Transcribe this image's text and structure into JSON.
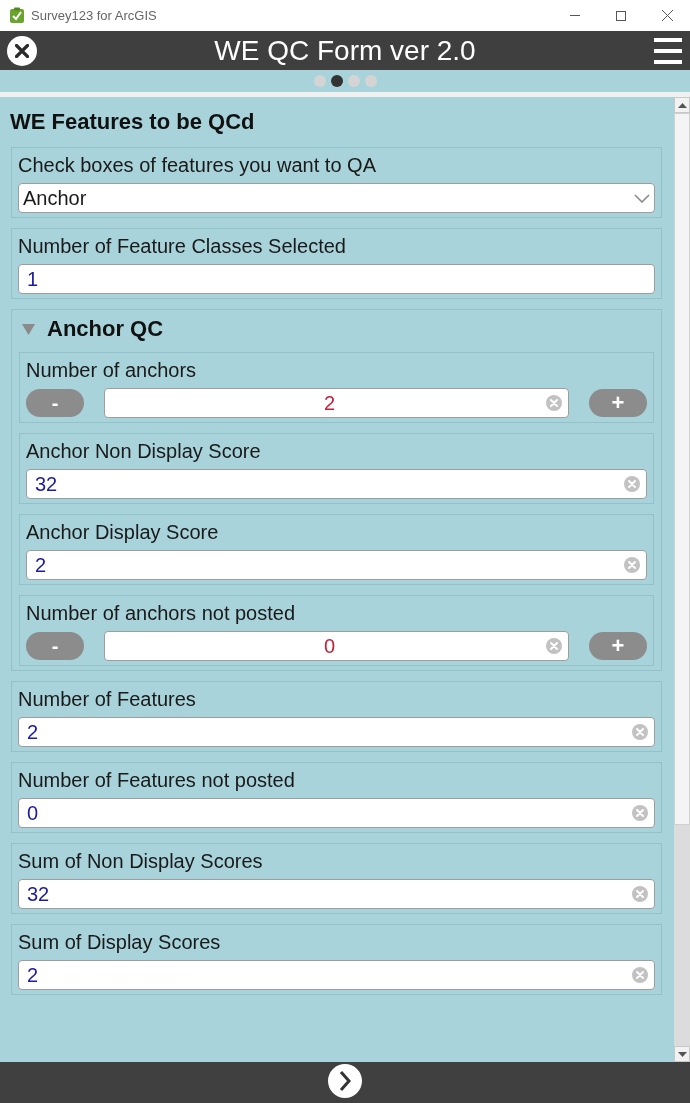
{
  "window": {
    "title": "Survey123 for ArcGIS"
  },
  "header": {
    "title": "WE QC Form ver 2.0"
  },
  "pager": [
    {
      "selected": false
    },
    {
      "selected": true
    },
    {
      "selected": false
    },
    {
      "selected": false
    }
  ],
  "form": {
    "title": "WE Features to be QCd",
    "questions": [
      {
        "kind": "select",
        "label": "Check boxes of features you want to QA",
        "value": "Anchor"
      },
      {
        "kind": "text",
        "label": "Number of Feature Classes Selected",
        "value": "1",
        "clear_button": false
      },
      {
        "kind": "group",
        "label": "Anchor QC",
        "expanded": true,
        "children": [
          {
            "kind": "stepper",
            "label": "Number of anchors",
            "value": "2",
            "minus": "-",
            "plus": "+",
            "clear_button": true
          },
          {
            "kind": "text",
            "label": "Anchor Non Display Score",
            "value": "32",
            "clear_button": true
          },
          {
            "kind": "text",
            "label": "Anchor Display Score",
            "value": "2",
            "clear_button": true
          },
          {
            "kind": "stepper",
            "label": "Number of anchors not posted",
            "value": "0",
            "minus": "-",
            "plus": "+",
            "clear_button": true
          }
        ]
      },
      {
        "kind": "text",
        "label": "Number of Features",
        "value": "2",
        "clear_button": true
      },
      {
        "kind": "text",
        "label": "Number of Features not posted",
        "value": "0",
        "clear_button": true
      },
      {
        "kind": "text",
        "label": "Sum of Non Display Scores",
        "value": "32",
        "clear_button": true
      },
      {
        "kind": "text",
        "label": "Sum of Display Scores",
        "value": "2",
        "clear_button": true
      }
    ]
  }
}
